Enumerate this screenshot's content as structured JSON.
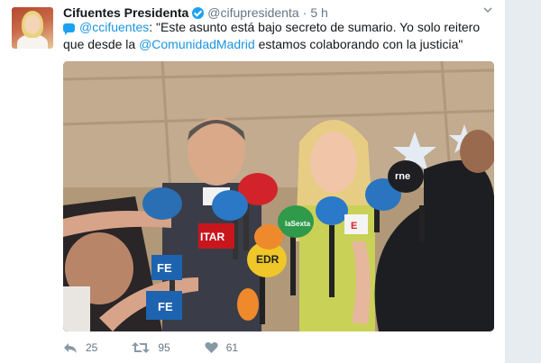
{
  "tweet": {
    "display_name": "Cifuentes Presidenta",
    "handle": "@cifupresidenta",
    "separator": "·",
    "time": "5 h",
    "text_mention": "@ccifuentes",
    "text_part1": ": \"Este asunto está bajo secreto de sumario. Yo solo reitero que desde la ",
    "text_mention2": "@ComunidadMadrid",
    "text_part2": " estamos colaborando con la justicia\"",
    "reply_count": "25",
    "retweet_count": "95",
    "like_count": "61"
  },
  "photo": {
    "mic_labels": {
      "mic1": "FE",
      "mic2": "FE",
      "mic3": "ITAR",
      "mic4": "EDR",
      "mic5": "laSexta",
      "mic6": "rne",
      "mic7": "E"
    }
  },
  "colors": {
    "accent": "#1da1f2",
    "link": "#1b95e0",
    "muted": "#657786"
  },
  "icons": [
    "verified-icon",
    "chevron-down-icon",
    "quote-bubble-icon",
    "reply-icon",
    "retweet-icon",
    "like-icon"
  ]
}
